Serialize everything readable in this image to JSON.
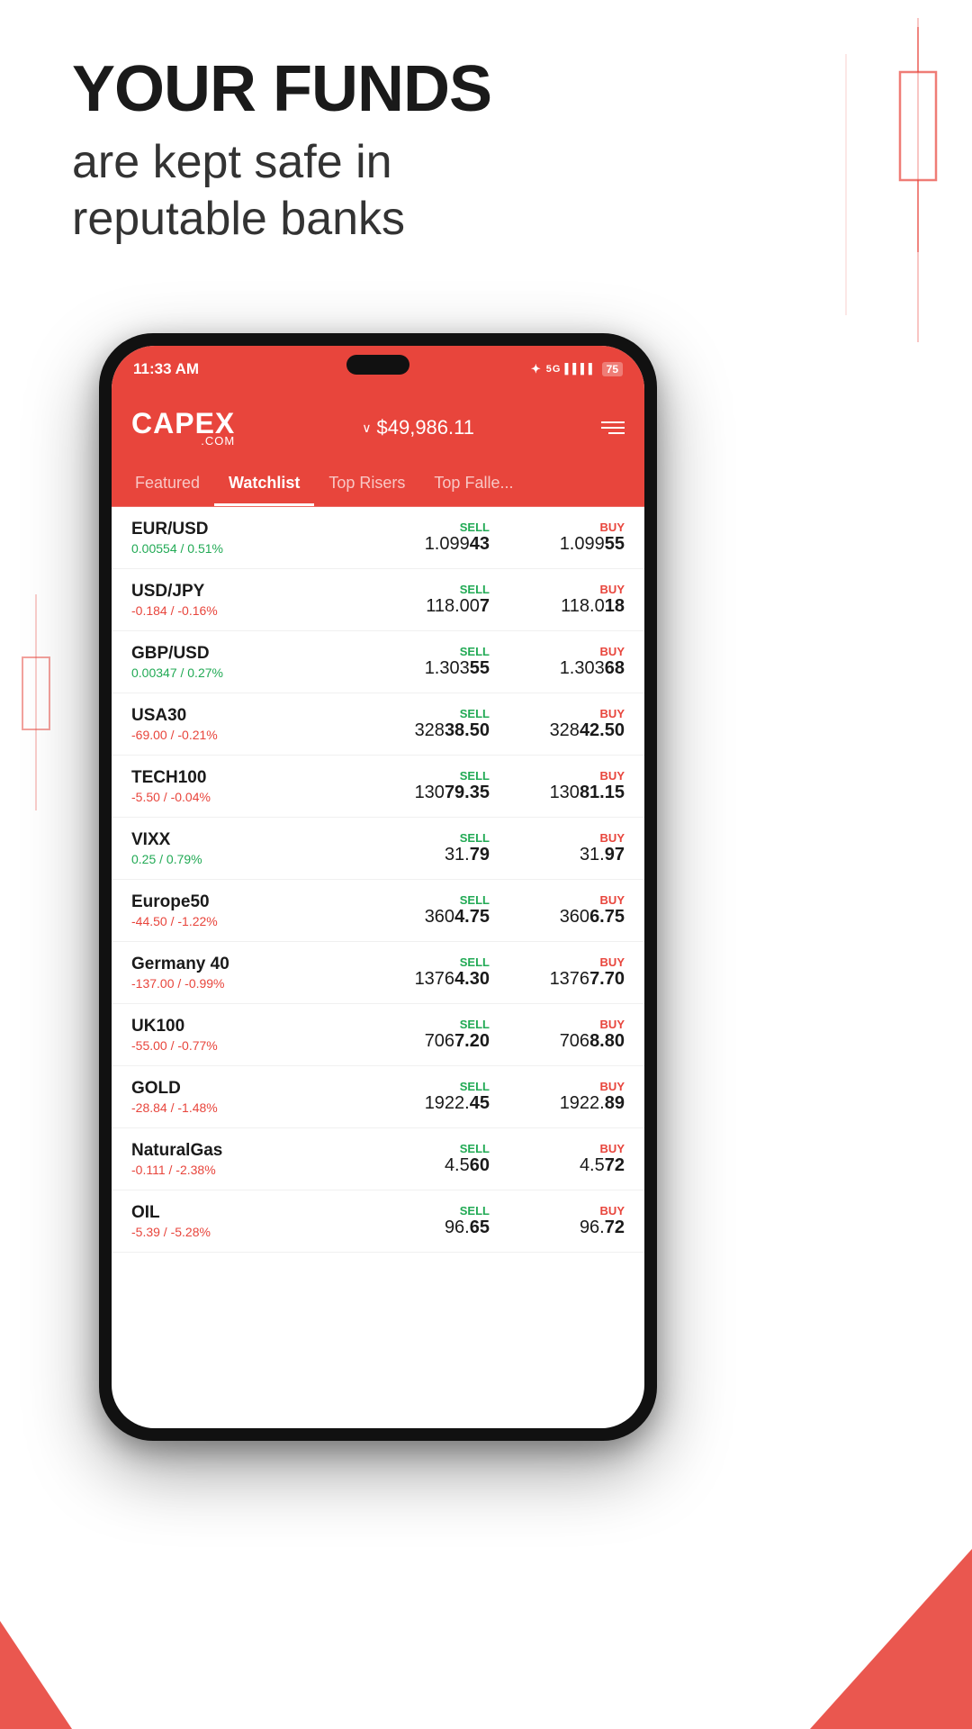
{
  "header": {
    "title_line1": "YOUR FUNDS",
    "title_line2": "are kept safe in",
    "title_line3": "reputable banks"
  },
  "status_bar": {
    "time": "11:33 AM",
    "battery": "75"
  },
  "app": {
    "logo": "CAPEX",
    "logo_sub": ".COM",
    "balance_arrow": "∨",
    "balance": "$49,986.11",
    "menu_label": "menu"
  },
  "nav": {
    "tabs": [
      {
        "label": "Featured",
        "active": false
      },
      {
        "label": "Watchlist",
        "active": true
      },
      {
        "label": "Top Risers",
        "active": false
      },
      {
        "label": "Top Falle...",
        "active": false
      }
    ]
  },
  "watchlist": {
    "instruments": [
      {
        "name": "EUR/USD",
        "change": "0.00554 / 0.51%",
        "change_positive": true,
        "sell_label": "SELL",
        "buy_label": "BUY",
        "sell_price_prefix": "1.099",
        "sell_price_bold": "43",
        "buy_price_prefix": "1.099",
        "buy_price_bold": "55"
      },
      {
        "name": "USD/JPY",
        "change": "-0.184 / -0.16%",
        "change_positive": false,
        "sell_label": "SELL",
        "buy_label": "BUY",
        "sell_price_prefix": "118.00",
        "sell_price_bold": "7",
        "buy_price_prefix": "118.0",
        "buy_price_bold": "18"
      },
      {
        "name": "GBP/USD",
        "change": "0.00347 / 0.27%",
        "change_positive": true,
        "sell_label": "SELL",
        "buy_label": "BUY",
        "sell_price_prefix": "1.303",
        "sell_price_bold": "55",
        "buy_price_prefix": "1.303",
        "buy_price_bold": "68"
      },
      {
        "name": "USA30",
        "change": "-69.00 / -0.21%",
        "change_positive": false,
        "sell_label": "SELL",
        "buy_label": "BUY",
        "sell_price_prefix": "328",
        "sell_price_bold": "38.50",
        "buy_price_prefix": "328",
        "buy_price_bold": "42.50"
      },
      {
        "name": "TECH100",
        "change": "-5.50 / -0.04%",
        "change_positive": false,
        "sell_label": "SELL",
        "buy_label": "BUY",
        "sell_price_prefix": "130",
        "sell_price_bold": "79.35",
        "buy_price_prefix": "130",
        "buy_price_bold": "81.15"
      },
      {
        "name": "VIXX",
        "change": "0.25 / 0.79%",
        "change_positive": true,
        "sell_label": "SELL",
        "buy_label": "BUY",
        "sell_price_prefix": "31.",
        "sell_price_bold": "79",
        "buy_price_prefix": "31.",
        "buy_price_bold": "97"
      },
      {
        "name": "Europe50",
        "change": "-44.50 / -1.22%",
        "change_positive": false,
        "sell_label": "SELL",
        "buy_label": "BUY",
        "sell_price_prefix": "360",
        "sell_price_bold": "4.75",
        "buy_price_prefix": "360",
        "buy_price_bold": "6.75"
      },
      {
        "name": "Germany 40",
        "change": "-137.00 / -0.99%",
        "change_positive": false,
        "sell_label": "SELL",
        "buy_label": "BUY",
        "sell_price_prefix": "1376",
        "sell_price_bold": "4.30",
        "buy_price_prefix": "1376",
        "buy_price_bold": "7.70"
      },
      {
        "name": "UK100",
        "change": "-55.00 / -0.77%",
        "change_positive": false,
        "sell_label": "SELL",
        "buy_label": "BUY",
        "sell_price_prefix": "706",
        "sell_price_bold": "7.20",
        "buy_price_prefix": "706",
        "buy_price_bold": "8.80"
      },
      {
        "name": "GOLD",
        "change": "-28.84 / -1.48%",
        "change_positive": false,
        "sell_label": "SELL",
        "buy_label": "BUY",
        "sell_price_prefix": "1922.",
        "sell_price_bold": "45",
        "buy_price_prefix": "1922.",
        "buy_price_bold": "89"
      },
      {
        "name": "NaturalGas",
        "change": "-0.111 / -2.38%",
        "change_positive": false,
        "sell_label": "SELL",
        "buy_label": "BUY",
        "sell_price_prefix": "4.5",
        "sell_price_bold": "60",
        "buy_price_prefix": "4.5",
        "buy_price_bold": "72"
      },
      {
        "name": "OIL",
        "change": "-5.39 / -5.28%",
        "change_positive": false,
        "sell_label": "SELL",
        "buy_label": "BUY",
        "sell_price_prefix": "96.",
        "sell_price_bold": "65",
        "buy_price_prefix": "96.",
        "buy_price_bold": "72"
      }
    ]
  }
}
